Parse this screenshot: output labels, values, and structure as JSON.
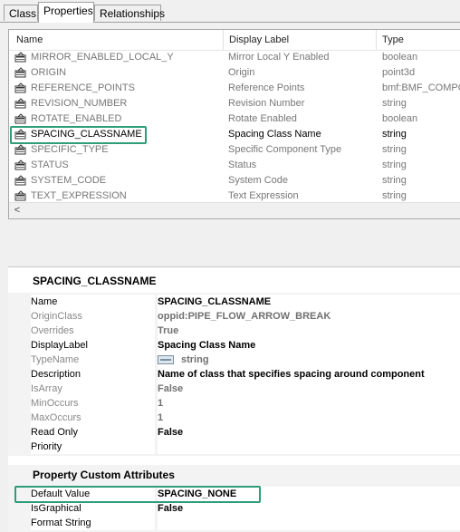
{
  "tabs": [
    {
      "label": "Class",
      "active": false
    },
    {
      "label": "Properties",
      "active": true
    },
    {
      "label": "Relationships",
      "active": false
    }
  ],
  "list": {
    "columns": [
      "Name",
      "Display Label",
      "Type"
    ],
    "rows": [
      {
        "name": "MIRROR_ENABLED_LOCAL_Y",
        "label": "Mirror Local Y Enabled",
        "type": "boolean"
      },
      {
        "name": "ORIGIN",
        "label": "Origin",
        "type": "point3d"
      },
      {
        "name": "REFERENCE_POINTS",
        "label": "Reference Points",
        "type": "bmf:BMF_COMPO"
      },
      {
        "name": "REVISION_NUMBER",
        "label": "Revision Number",
        "type": "string"
      },
      {
        "name": "ROTATE_ENABLED",
        "label": "Rotate Enabled",
        "type": "boolean"
      },
      {
        "name": "SPACING_CLASSNAME",
        "label": "Spacing Class Name",
        "type": "string",
        "selected": true
      },
      {
        "name": "SPECIFIC_TYPE",
        "label": "Specific Component Type",
        "type": "string"
      },
      {
        "name": "STATUS",
        "label": "Status",
        "type": "string"
      },
      {
        "name": "SYSTEM_CODE",
        "label": "System Code",
        "type": "string"
      },
      {
        "name": "TEXT_EXPRESSION",
        "label": "Text Expression",
        "type": "string"
      }
    ],
    "scroll_left": "<"
  },
  "details": {
    "title": "SPACING_CLASSNAME",
    "properties": [
      {
        "label": "Name",
        "value": "SPACING_CLASSNAME",
        "label_dim": false,
        "value_dim": false
      },
      {
        "label": "OriginClass",
        "value": "oppid:PIPE_FLOW_ARROW_BREAK",
        "label_dim": true,
        "value_dim": true
      },
      {
        "label": "Overrides",
        "value": "True",
        "label_dim": true,
        "value_dim": true
      },
      {
        "label": "DisplayLabel",
        "value": "Spacing Class Name",
        "label_dim": false,
        "value_dim": false
      },
      {
        "label": "TypeName",
        "value": "string",
        "label_dim": true,
        "value_dim": true
      },
      {
        "label": "Description",
        "value": "Name of class that specifies spacing around component",
        "label_dim": false,
        "value_dim": false
      },
      {
        "label": "IsArray",
        "value": "False",
        "label_dim": true,
        "value_dim": true
      },
      {
        "label": "MinOccurs",
        "value": "1",
        "label_dim": true,
        "value_dim": true
      },
      {
        "label": "MaxOccurs",
        "value": "1",
        "label_dim": true,
        "value_dim": true
      },
      {
        "label": "Read Only",
        "value": "False",
        "label_dim": false,
        "value_dim": false
      },
      {
        "label": "Priority",
        "value": "",
        "label_dim": false,
        "value_dim": false
      }
    ]
  },
  "custom_attributes": {
    "title": "Property Custom Attributes",
    "items": [
      {
        "label": "Default Value",
        "value": "SPACING_NONE"
      },
      {
        "label": "IsGraphical",
        "value": "False"
      },
      {
        "label": "Format String",
        "value": ""
      }
    ]
  },
  "colors": {
    "highlight": "#2d9d7a"
  }
}
